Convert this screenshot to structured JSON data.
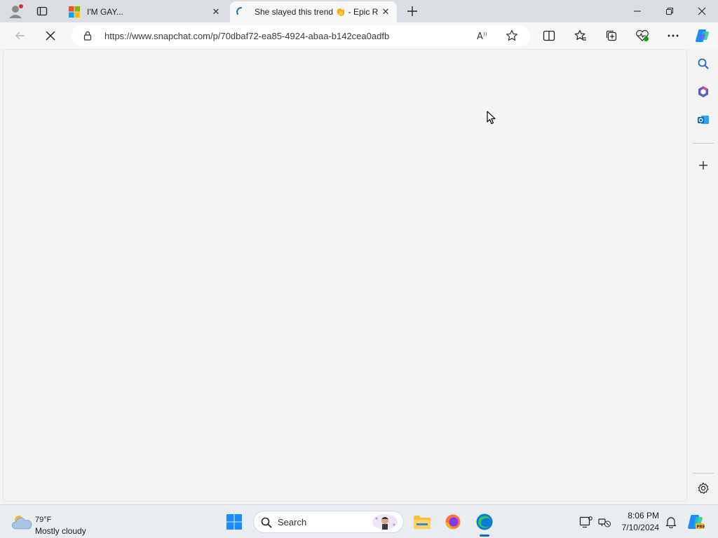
{
  "browser": {
    "tabs": [
      {
        "label": "I'M GAY...",
        "active": false
      },
      {
        "label": "She slayed this trend 👏 - Epic R",
        "active": true
      }
    ],
    "address_bar": {
      "url": "https://www.snapchat.com/p/70dbaf72-ea85-4924-abaa-b142cea0adfb"
    }
  },
  "taskbar": {
    "weather": {
      "temp": "79°F",
      "description": "Mostly cloudy"
    },
    "search": {
      "label": "Search"
    },
    "clock": {
      "time": "8:06 PM",
      "date": "7/10/2024"
    }
  },
  "colors": {
    "accent": "#0f6cbd",
    "page_background": "#f5f5f5",
    "taskbar": "#e9edf2"
  }
}
